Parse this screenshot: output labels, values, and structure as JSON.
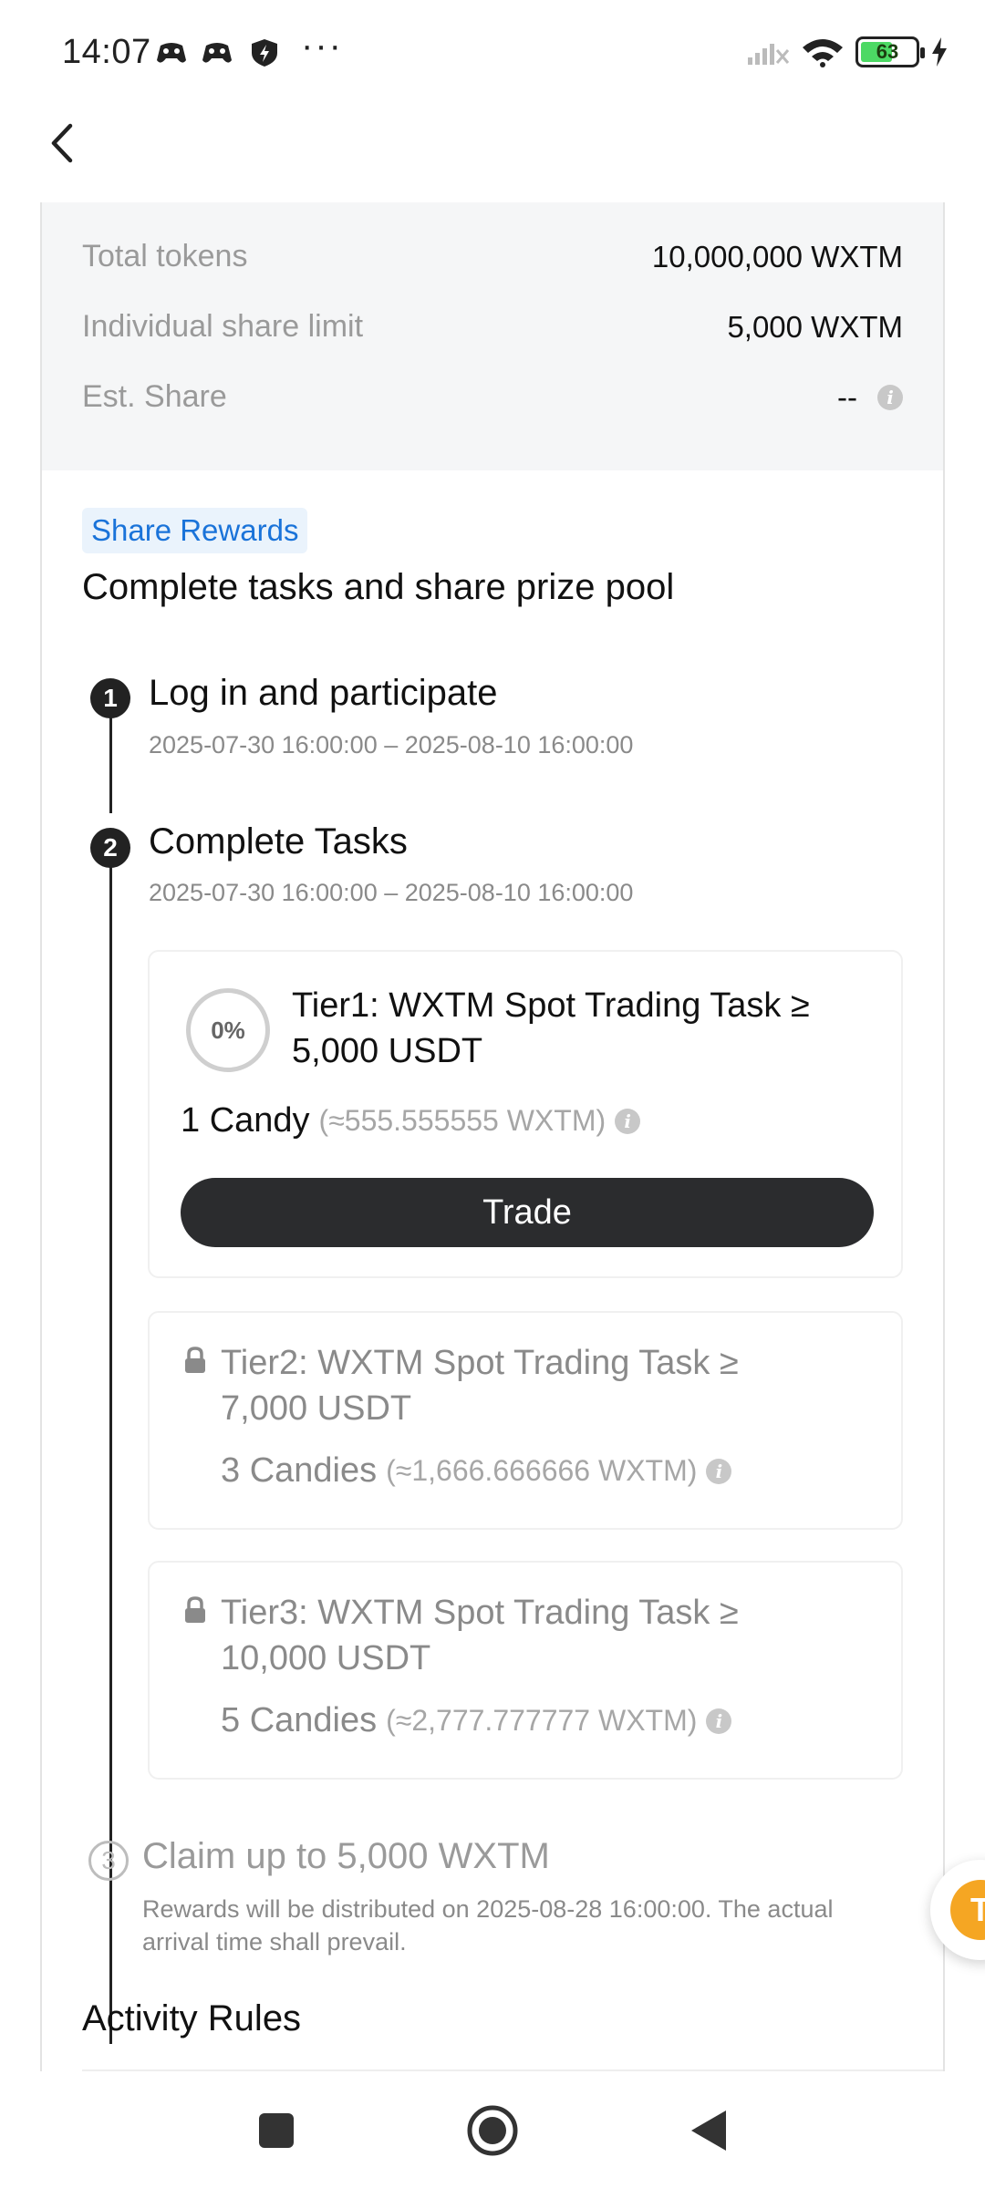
{
  "status_bar": {
    "time": "14:07",
    "more": "···",
    "battery_level": "63",
    "battery_fraction": 0.63
  },
  "header": {
    "back_icon": "chevron-left-icon"
  },
  "summary": {
    "total_tokens_label": "Total tokens",
    "total_tokens_value": "10,000,000 WXTM",
    "share_limit_label": "Individual share limit",
    "share_limit_value": "5,000 WXTM",
    "est_share_label": "Est. Share",
    "est_share_value": "--"
  },
  "rewards": {
    "badge": "Share Rewards",
    "headline": "Complete tasks and share prize pool"
  },
  "steps": [
    {
      "num": "1",
      "title": "Log in and participate",
      "time": "2025-07-30 16:00:00 – 2025-08-10 16:00:00"
    },
    {
      "num": "2",
      "title": "Complete Tasks",
      "time": "2025-07-30 16:00:00 – 2025-08-10 16:00:00"
    },
    {
      "num": "3",
      "title": "Claim up to 5,000 WXTM",
      "note": "Rewards will be distributed on 2025-08-28 16:00:00. The actual arrival time shall prevail."
    }
  ],
  "tasks": [
    {
      "progress": "0%",
      "title_line1": "Tier1: WXTM Spot Trading Task ≥",
      "title_line2": "5,000 USDT",
      "reward": "1 Candy",
      "approx": "(≈555.555555 WXTM)",
      "button": "Trade"
    },
    {
      "title_line1": "Tier2: WXTM Spot Trading Task ≥",
      "title_line2": "7,000 USDT",
      "reward": "3 Candies",
      "approx": "(≈1,666.666666 WXTM)"
    },
    {
      "title_line1": "Tier3: WXTM Spot Trading Task ≥",
      "title_line2": "10,000 USDT",
      "reward": "5 Candies",
      "approx": "(≈2,777.777777 WXTM)"
    }
  ],
  "rules": {
    "title": "Activity Rules"
  },
  "float_button": {
    "glyph": "T"
  },
  "colors": {
    "accent_blue": "#1a73d9",
    "button_dark": "#2b2c2e",
    "float_orange": "#f5a623"
  }
}
